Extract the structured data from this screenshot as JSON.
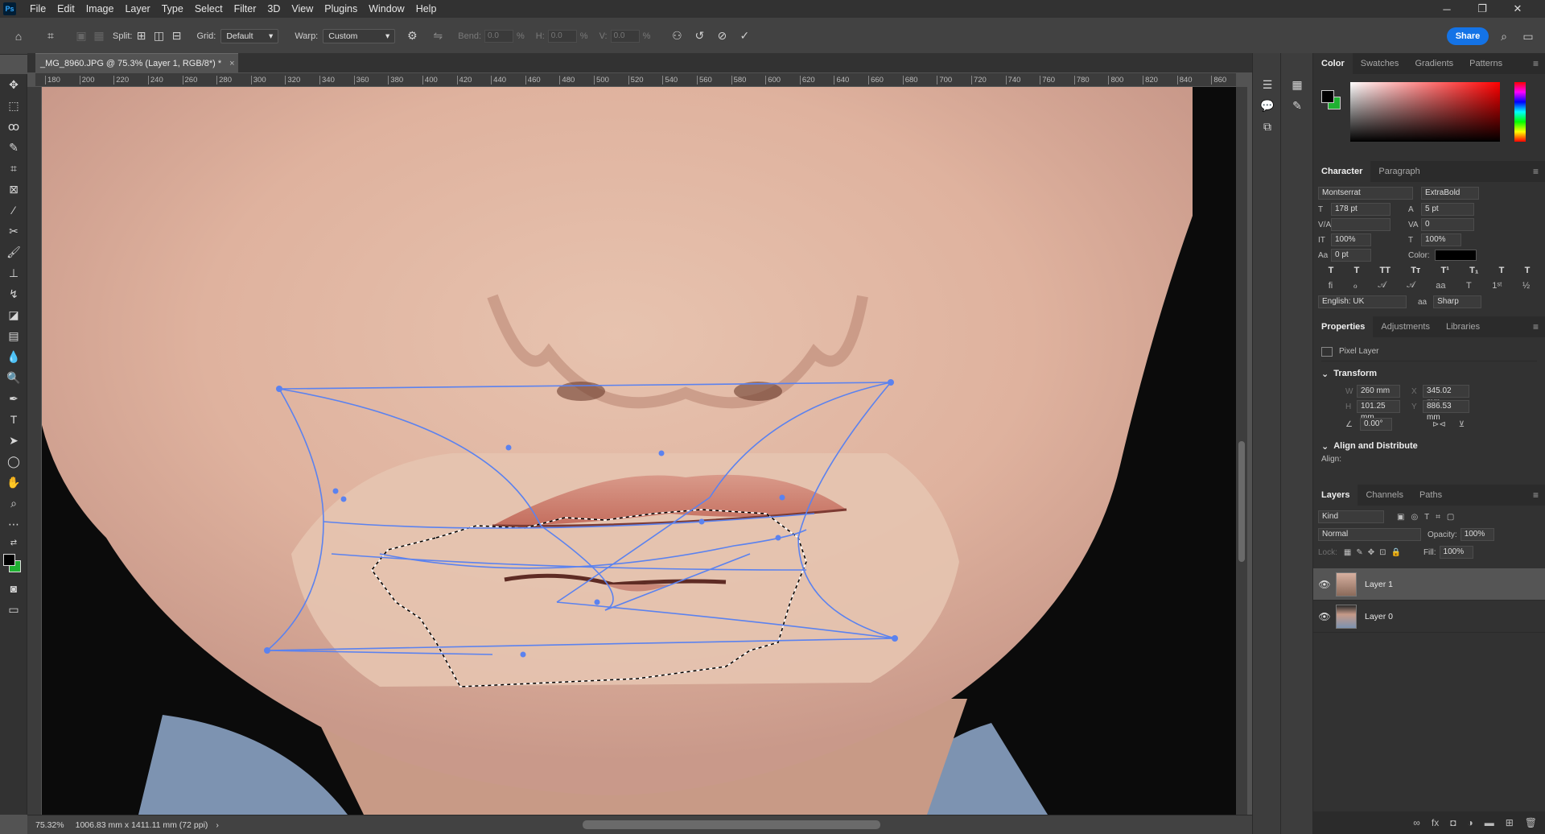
{
  "menu": [
    "File",
    "Edit",
    "Image",
    "Layer",
    "Type",
    "Select",
    "Filter",
    "3D",
    "View",
    "Plugins",
    "Window",
    "Help"
  ],
  "app_logo": "Ps",
  "window": {
    "minimize": "─",
    "restore": "❐",
    "close": "✕"
  },
  "options": {
    "split_label": "Split:",
    "grid_label": "Grid:",
    "grid_value": "Default",
    "warp_label": "Warp:",
    "warp_value": "Custom",
    "bend_label": "Bend:",
    "bend_value": "0.0",
    "bend_unit": "%",
    "h_label": "H:",
    "h_value": "0.0",
    "h_unit": "%",
    "v_label": "V:",
    "v_value": "0.0",
    "v_unit": "%",
    "share": "Share"
  },
  "document": {
    "tab_title": "_MG_8960.JPG @ 75.3% (Layer 1, RGB/8*) *",
    "close": "×"
  },
  "ruler_h_ticks": [
    "180",
    "200",
    "220",
    "240",
    "260",
    "280",
    "300",
    "320",
    "340",
    "360",
    "380",
    "400",
    "420",
    "440",
    "460",
    "480",
    "500",
    "520",
    "540",
    "560",
    "580",
    "600",
    "620",
    "640",
    "660",
    "680",
    "700",
    "720",
    "740",
    "760",
    "780",
    "800",
    "820",
    "840",
    "860"
  ],
  "status": {
    "zoom": "75.32%",
    "dimensions": "1006.83 mm x 1411.11 mm (72 ppi)",
    "arrow": "›"
  },
  "color_panel": {
    "tabs": [
      "Color",
      "Swatches",
      "Gradients",
      "Patterns"
    ],
    "fg": "#000000",
    "bg": "#1fb131"
  },
  "character_panel": {
    "tabs": [
      "Character",
      "Paragraph"
    ],
    "font_family": "Montserrat",
    "font_style": "ExtraBold",
    "size": "178 pt",
    "leading": "5 pt",
    "kerning": "",
    "tracking": "0",
    "vscale": "100%",
    "hscale": "100%",
    "baseline": "0 pt",
    "color_label": "Color:",
    "language": "English: UK",
    "aa_icon": "aa",
    "antialias": "Sharp"
  },
  "properties_panel": {
    "tabs": [
      "Properties",
      "Adjustments",
      "Libraries"
    ],
    "layer_type": "Pixel Layer",
    "transform_title": "Transform",
    "w_label": "W",
    "w_value": "260 mm",
    "x_label": "X",
    "x_value": "345.02 mm",
    "h_label": "H",
    "h_value": "101.25 mm",
    "y_label": "Y",
    "y_value": "886.53 mm",
    "angle_value": "0.00°",
    "align_title": "Align and Distribute",
    "align_label": "Align:"
  },
  "layers_panel": {
    "tabs": [
      "Layers",
      "Channels",
      "Paths"
    ],
    "kind_placeholder": "Kind",
    "blend_mode": "Normal",
    "opacity_label": "Opacity:",
    "opacity_value": "100%",
    "lock_label": "Lock:",
    "fill_label": "Fill:",
    "fill_value": "100%",
    "layers": [
      {
        "name": "Layer 1",
        "selected": true
      },
      {
        "name": "Layer 0",
        "selected": false
      }
    ]
  }
}
